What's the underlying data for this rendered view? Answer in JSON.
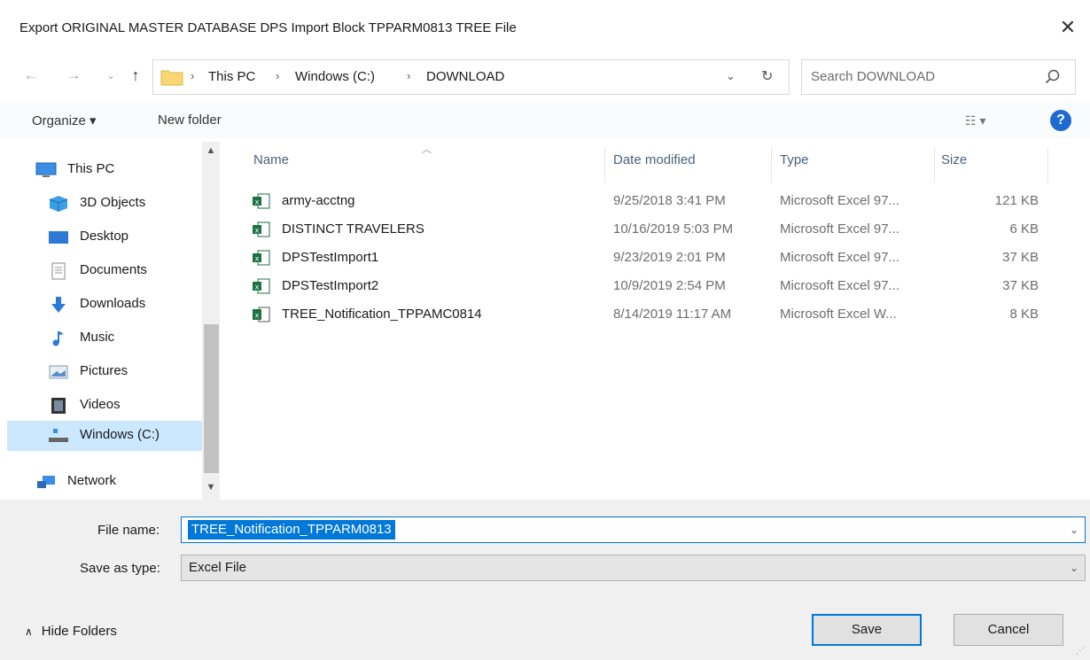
{
  "title": "Export ORIGINAL MASTER DATABASE DPS Import Block TPPARM0813 TREE File",
  "nav": {
    "back": "←",
    "forward": "→",
    "recent": "⌄",
    "up": "↑",
    "breadcrumbs": [
      "This PC",
      "Windows (C:)",
      "DOWNLOAD"
    ],
    "separator": "›",
    "search_placeholder": "Search DOWNLOAD"
  },
  "toolbar": {
    "organize": "Organize ▾",
    "new_folder": "New folder"
  },
  "sidebar": {
    "items": [
      {
        "label": "This PC",
        "icon": "pc-icon"
      },
      {
        "label": "3D Objects",
        "icon": "cube-icon"
      },
      {
        "label": "Desktop",
        "icon": "desktop-icon"
      },
      {
        "label": "Documents",
        "icon": "document-icon"
      },
      {
        "label": "Downloads",
        "icon": "download-arrow-icon"
      },
      {
        "label": "Music",
        "icon": "music-note-icon"
      },
      {
        "label": "Pictures",
        "icon": "picture-icon"
      },
      {
        "label": "Videos",
        "icon": "film-icon"
      },
      {
        "label": "Windows (C:)",
        "icon": "drive-icon",
        "selected": true
      },
      {
        "label": "Network",
        "icon": "network-icon"
      }
    ]
  },
  "columns": {
    "name": "Name",
    "date": "Date modified",
    "type": "Type",
    "size": "Size"
  },
  "files": [
    {
      "name": "army-acctng",
      "date": "9/25/2018 3:41 PM",
      "type": "Microsoft Excel 97...",
      "size": "121 KB"
    },
    {
      "name": "DISTINCT TRAVELERS",
      "date": "10/16/2019 5:03 PM",
      "type": "Microsoft Excel 97...",
      "size": "6 KB"
    },
    {
      "name": "DPSTestImport1",
      "date": "9/23/2019 2:01 PM",
      "type": "Microsoft Excel 97...",
      "size": "37 KB"
    },
    {
      "name": "DPSTestImport2",
      "date": "10/9/2019 2:54 PM",
      "type": "Microsoft Excel 97...",
      "size": "37 KB"
    },
    {
      "name": "TREE_Notification_TPPAMC0814",
      "date": "8/14/2019 11:17 AM",
      "type": "Microsoft Excel W...",
      "size": "8 KB"
    }
  ],
  "form": {
    "file_name_label": "File name:",
    "file_name_value": "TREE_Notification_TPPARM0813",
    "save_type_label": "Save as type:",
    "save_type_value": "Excel File",
    "hide_folders": "Hide Folders",
    "save_button": "Save",
    "cancel_button": "Cancel"
  },
  "colors": {
    "accent": "#0078d7",
    "selected_bg": "#cce8ff",
    "excel_green": "#1e7145",
    "help_blue": "#1c6bd1"
  }
}
